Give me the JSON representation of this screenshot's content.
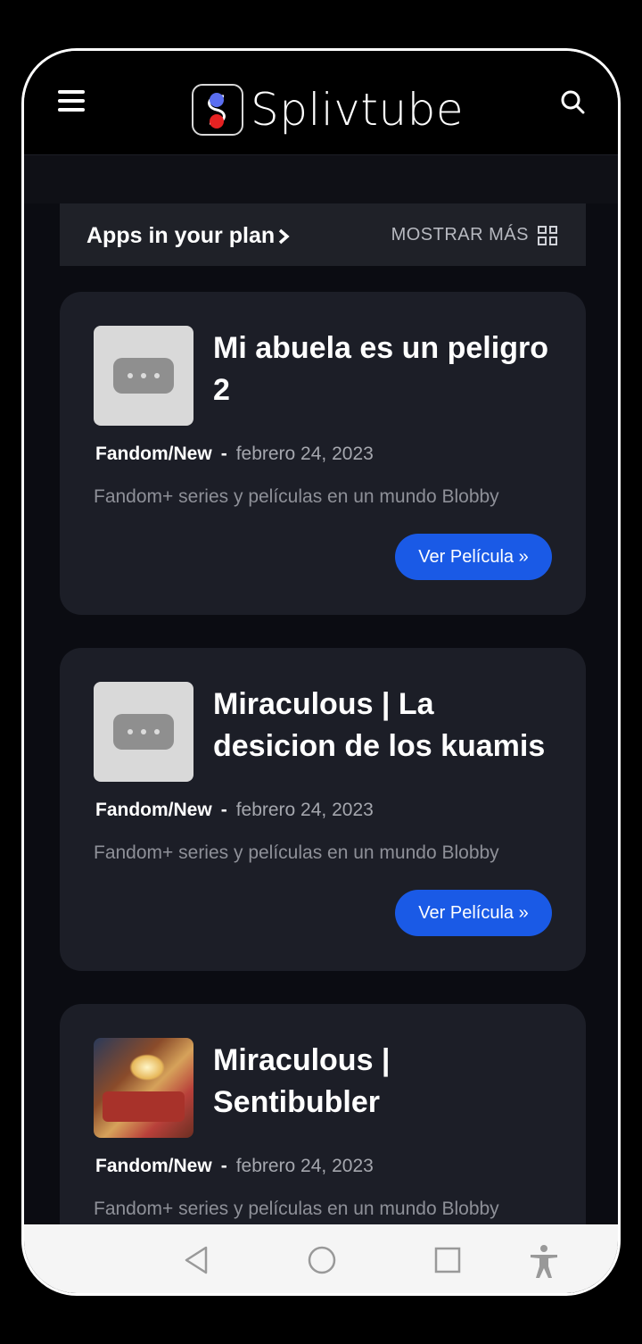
{
  "app": {
    "brand": "Splivtube"
  },
  "plan_bar": {
    "title": "Apps in your plan",
    "more_label": "MOSTRAR MÁS"
  },
  "cards": [
    {
      "title": "Mi abuela es un peligro 2",
      "category": "Fandom/New",
      "separator": "-",
      "date": "febrero 24, 2023",
      "description": "Fandom+ series y películas en un mundo Blobby",
      "button": "Ver Película »"
    },
    {
      "title": "Miraculous | La desicion de los kuamis",
      "category": "Fandom/New",
      "separator": "-",
      "date": "febrero 24, 2023",
      "description": "Fandom+ series y películas en un mundo Blobby",
      "button": "Ver Película »"
    },
    {
      "title": "Miraculous | Sentibubler",
      "category": "Fandom/New",
      "separator": "-",
      "date": "febrero 24, 2023",
      "description": "Fandom+ series y películas en un mundo Blobby"
    }
  ],
  "icons": {
    "menu": "hamburger-icon",
    "search": "search-icon",
    "grid": "grid-icon",
    "back": "back-icon",
    "home": "home-icon",
    "recents": "recents-icon",
    "accessibility": "accessibility-icon"
  },
  "colors": {
    "accent": "#1a5ae6",
    "card": "#1c1e27",
    "background": "#0b0c12"
  }
}
